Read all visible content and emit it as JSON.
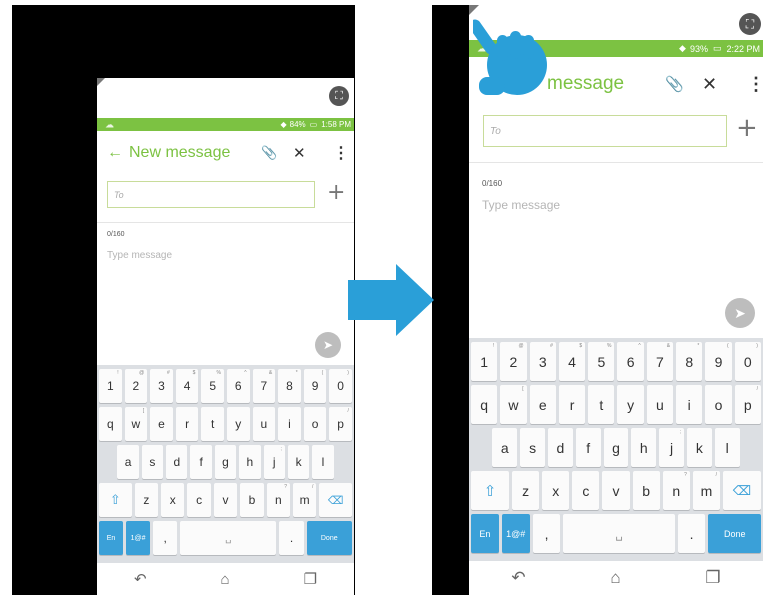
{
  "screen_before": {
    "status": {
      "battery": "84%",
      "time": "1:58 PM"
    },
    "header": {
      "back": "←",
      "title": "New message",
      "attach": "📎",
      "close": "✕",
      "menu": "⋮"
    },
    "to_placeholder": "To",
    "plus": "+",
    "counter": "0/160",
    "message_placeholder": "Type message",
    "send": "➤",
    "expand": "⛶"
  },
  "screen_after": {
    "status": {
      "battery": "93%",
      "time": "2:22 PM"
    },
    "header": {
      "title_partial": "message",
      "attach": "📎",
      "close": "✕",
      "menu": "⋮"
    },
    "to_placeholder": "To",
    "plus": "+",
    "counter": "0/160",
    "message_placeholder": "Type message",
    "send": "➤",
    "expand": "⛶"
  },
  "keyboard": {
    "row1": [
      {
        "k": "1",
        "h": "!"
      },
      {
        "k": "2",
        "h": "@"
      },
      {
        "k": "3",
        "h": "#"
      },
      {
        "k": "4",
        "h": "$"
      },
      {
        "k": "5",
        "h": "%"
      },
      {
        "k": "6",
        "h": "^"
      },
      {
        "k": "7",
        "h": "&"
      },
      {
        "k": "8",
        "h": "*"
      },
      {
        "k": "9",
        "h": "("
      },
      {
        "k": "0",
        "h": ")"
      }
    ],
    "row2": [
      {
        "k": "q",
        "h": ""
      },
      {
        "k": "w",
        "h": "["
      },
      {
        "k": "e",
        "h": ""
      },
      {
        "k": "r",
        "h": ""
      },
      {
        "k": "t",
        "h": ""
      },
      {
        "k": "y",
        "h": ""
      },
      {
        "k": "u",
        "h": ""
      },
      {
        "k": "i",
        "h": ""
      },
      {
        "k": "o",
        "h": ""
      },
      {
        "k": "p",
        "h": "/"
      }
    ],
    "row3": [
      {
        "k": "a",
        "h": ""
      },
      {
        "k": "s",
        "h": ""
      },
      {
        "k": "d",
        "h": ""
      },
      {
        "k": "f",
        "h": ""
      },
      {
        "k": "g",
        "h": ""
      },
      {
        "k": "h",
        "h": ""
      },
      {
        "k": "j",
        "h": ";"
      },
      {
        "k": "k",
        "h": ""
      },
      {
        "k": "l",
        "h": ""
      }
    ],
    "row4": [
      {
        "k": "z",
        "h": ""
      },
      {
        "k": "x",
        "h": ""
      },
      {
        "k": "c",
        "h": ""
      },
      {
        "k": "v",
        "h": ""
      },
      {
        "k": "b",
        "h": ""
      },
      {
        "k": "n",
        "h": "?"
      },
      {
        "k": "m",
        "h": "/"
      }
    ],
    "shift": "⇧",
    "backspace": "⌫",
    "lang": "En",
    "symbols": "1@#",
    "comma": ",",
    "space": "␣",
    "period": ".",
    "done": "Done"
  },
  "navbar": {
    "back": "↶",
    "home": "⌂",
    "recents": "❐"
  },
  "arrow_color": "#2a9fd8",
  "accent_color": "#7cc242"
}
